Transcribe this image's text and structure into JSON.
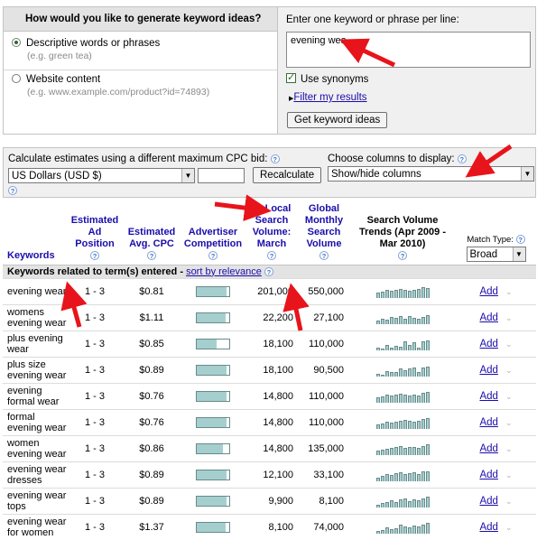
{
  "left_panel": {
    "header": "How would you like to generate keyword ideas?",
    "option1_label": "Descriptive words or phrases",
    "option1_hint": "(e.g. green tea)",
    "option2_label": "Website content",
    "option2_hint": "(e.g. www.example.com/product?id=74893)"
  },
  "right_panel": {
    "label": "Enter one keyword or phrase per line:",
    "keyword_value": "evening wea",
    "synonyms_label": "Use synonyms",
    "filter_link": "Filter my results",
    "get_ideas_button": "Get keyword ideas"
  },
  "cpc": {
    "label": "Calculate estimates using a different maximum CPC bid:",
    "currency": "US Dollars (USD $)",
    "bid_value": "",
    "recalc_button": "Recalculate",
    "columns_label": "Choose columns to display:",
    "columns_select": "Show/hide columns"
  },
  "table": {
    "headers": {
      "keywords": "Keywords",
      "ad_position": "Estimated Ad Position",
      "avg_cpc": "Estimated Avg. CPC",
      "competition": "Advertiser Competition",
      "local": "▼ Local Search Volume: March",
      "global": "Global Monthly Search Volume",
      "trends": "Search Volume Trends (Apr 2009 - Mar 2010)",
      "match_type_label": "Match Type:",
      "match_type_value": "Broad"
    },
    "group_label": "Keywords related to term(s) entered -",
    "sort_link": "sort by relevance",
    "add_label": "Add",
    "rows": [
      {
        "keyword": "evening wear",
        "position": "1 - 3",
        "cpc": "$0.81",
        "competition": 0.93,
        "local": "201,000",
        "global": "550,000",
        "trend": [
          6,
          7,
          9,
          8,
          9,
          10,
          9,
          8,
          9,
          10,
          12,
          11
        ]
      },
      {
        "keyword": "womens evening wear",
        "position": "1 - 3",
        "cpc": "$1.11",
        "competition": 0.88,
        "local": "22,200",
        "global": "27,100",
        "trend": [
          4,
          6,
          5,
          8,
          7,
          9,
          6,
          9,
          7,
          6,
          8,
          10
        ]
      },
      {
        "keyword": "plus evening wear",
        "position": "1 - 3",
        "cpc": "$0.85",
        "competition": 0.6,
        "local": "18,100",
        "global": "110,000",
        "trend": [
          3,
          2,
          6,
          3,
          5,
          4,
          10,
          6,
          9,
          3,
          10,
          11
        ]
      },
      {
        "keyword": "plus size evening wear",
        "position": "1 - 3",
        "cpc": "$0.89",
        "competition": 0.93,
        "local": "18,100",
        "global": "90,500",
        "trend": [
          3,
          2,
          6,
          5,
          5,
          9,
          7,
          9,
          10,
          5,
          10,
          11
        ]
      },
      {
        "keyword": "evening formal wear",
        "position": "1 - 3",
        "cpc": "$0.76",
        "competition": 0.93,
        "local": "14,800",
        "global": "110,000",
        "trend": [
          6,
          7,
          9,
          8,
          9,
          10,
          9,
          8,
          9,
          8,
          11,
          12
        ]
      },
      {
        "keyword": "formal evening wear",
        "position": "1 - 3",
        "cpc": "$0.76",
        "competition": 0.93,
        "local": "14,800",
        "global": "110,000",
        "trend": [
          5,
          6,
          8,
          7,
          8,
          9,
          10,
          9,
          8,
          9,
          11,
          12
        ]
      },
      {
        "keyword": "women evening wear",
        "position": "1 - 3",
        "cpc": "$0.86",
        "competition": 0.8,
        "local": "14,800",
        "global": "135,000",
        "trend": [
          5,
          6,
          7,
          8,
          9,
          10,
          8,
          9,
          9,
          8,
          10,
          12
        ]
      },
      {
        "keyword": "evening wear dresses",
        "position": "1 - 3",
        "cpc": "$0.89",
        "competition": 0.93,
        "local": "12,100",
        "global": "33,100",
        "trend": [
          4,
          6,
          8,
          7,
          9,
          10,
          8,
          9,
          10,
          8,
          11,
          11
        ]
      },
      {
        "keyword": "evening wear tops",
        "position": "1 - 3",
        "cpc": "$0.89",
        "competition": 0.93,
        "local": "9,900",
        "global": "8,100",
        "trend": [
          3,
          5,
          6,
          8,
          6,
          9,
          10,
          7,
          9,
          8,
          10,
          12
        ]
      },
      {
        "keyword": "evening wear for women",
        "position": "1 - 3",
        "cpc": "$1.37",
        "competition": 0.9,
        "local": "8,100",
        "global": "74,000",
        "trend": [
          3,
          4,
          7,
          5,
          6,
          10,
          8,
          7,
          9,
          8,
          10,
          12
        ]
      }
    ]
  },
  "colors": {
    "accent_link": "#1a0dab",
    "bar_fill": "#a5cfcf",
    "arrow_red": "#e8141b"
  }
}
